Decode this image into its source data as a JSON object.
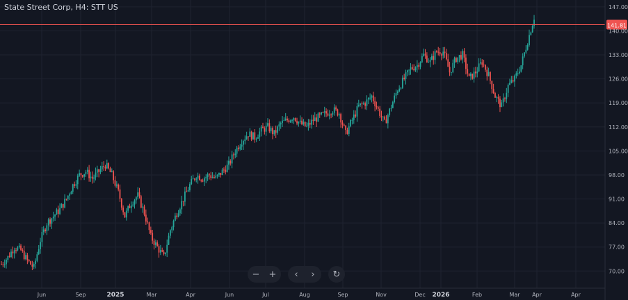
{
  "header": {
    "title": "State Street Corp, H4: STT US"
  },
  "controls": {
    "zoom_out": "−",
    "zoom_in": "+",
    "scroll_left": "‹",
    "scroll_right": "›",
    "reset": "↻"
  },
  "colors": {
    "background": "#131722",
    "grid": "#1f2330",
    "up": "#26a69a",
    "down": "#ef5350",
    "axis_text": "#b2b5be",
    "price_line": "#ef5350"
  },
  "chart_data": {
    "type": "candlestick",
    "title": "State Street Corp, H4: STT US",
    "last_price": "141.81",
    "ylim": [
      65,
      149
    ],
    "y_ticks": [
      "70.00",
      "77.00",
      "84.00",
      "91.00",
      "98.00",
      "105.00",
      "112.00",
      "119.00",
      "126.00",
      "133.00",
      "140.00",
      "147.00"
    ],
    "x_ticks": [
      "Jun",
      "Sep",
      "2025",
      "Mar",
      "Apr",
      "Jun",
      "Jul",
      "Aug",
      "Sep",
      "Nov",
      "Dec",
      "2026",
      "Feb",
      "Mar",
      "Apr",
      "Apr"
    ],
    "bold_x_ticks": [
      "2025",
      "2026"
    ],
    "series": [
      {
        "name": "STT",
        "close_path": [
          [
            "Jun",
            72
          ],
          [
            "Jun",
            74
          ],
          [
            "Jun",
            77
          ],
          [
            "Jun",
            76
          ],
          [
            "Jun",
            73
          ],
          [
            "Jun",
            71
          ],
          [
            "Sep",
            79
          ],
          [
            "Sep",
            84
          ],
          [
            "Sep",
            86
          ],
          [
            "Sep",
            88
          ],
          [
            "Sep",
            91
          ],
          [
            "Sep",
            95
          ],
          [
            "Sep",
            98
          ],
          [
            "2025",
            99
          ],
          [
            "2025",
            97
          ],
          [
            "2025",
            99
          ],
          [
            "2025",
            101
          ],
          [
            "2025",
            98
          ],
          [
            "Mar",
            93
          ],
          [
            "Mar",
            86
          ],
          [
            "Mar",
            90
          ],
          [
            "Mar",
            92
          ],
          [
            "Mar",
            87
          ],
          [
            "Mar",
            80
          ],
          [
            "Mar",
            77
          ],
          [
            "Mar",
            74
          ],
          [
            "Apr",
            82
          ],
          [
            "Apr",
            87
          ],
          [
            "Apr",
            91
          ],
          [
            "Apr",
            95
          ],
          [
            "Apr",
            98
          ],
          [
            "Apr",
            97
          ],
          [
            "Jun",
            98
          ],
          [
            "Jun",
            97
          ],
          [
            "Jun",
            99
          ],
          [
            "Jun",
            101
          ],
          [
            "Jun",
            105
          ],
          [
            "Jun",
            108
          ],
          [
            "Jun",
            110
          ],
          [
            "Jul",
            109
          ],
          [
            "Jul",
            111
          ],
          [
            "Jul",
            112
          ],
          [
            "Jul",
            110
          ],
          [
            "Jul",
            113
          ],
          [
            "Jul",
            114
          ],
          [
            "Aug",
            115
          ],
          [
            "Aug",
            113
          ],
          [
            "Aug",
            112
          ],
          [
            "Aug",
            114
          ],
          [
            "Aug",
            115
          ],
          [
            "Aug",
            116
          ],
          [
            "Sep",
            117
          ],
          [
            "Sep",
            116
          ],
          [
            "Sep",
            110
          ],
          [
            "Sep",
            114
          ],
          [
            "Sep",
            118
          ],
          [
            "Sep",
            119
          ],
          [
            "Nov",
            121
          ],
          [
            "Nov",
            117
          ],
          [
            "Nov",
            113
          ],
          [
            "Nov",
            118
          ],
          [
            "Nov",
            123
          ],
          [
            "Nov",
            126
          ],
          [
            "Dec",
            129
          ],
          [
            "Dec",
            130
          ],
          [
            "Dec",
            133
          ],
          [
            "Dec",
            131
          ],
          [
            "2026",
            134
          ],
          [
            "2026",
            134
          ],
          [
            "2026",
            128
          ],
          [
            "2026",
            132
          ],
          [
            "2026",
            133
          ],
          [
            "2026",
            126
          ],
          [
            "Feb",
            128
          ],
          [
            "Feb",
            131
          ],
          [
            "Feb",
            127
          ],
          [
            "Feb",
            121
          ],
          [
            "Feb",
            118
          ],
          [
            "Feb",
            124
          ],
          [
            "Mar",
            126
          ],
          [
            "Mar",
            130
          ],
          [
            "Mar",
            137
          ],
          [
            "Mar",
            144
          ]
        ]
      }
    ],
    "grid": true
  }
}
